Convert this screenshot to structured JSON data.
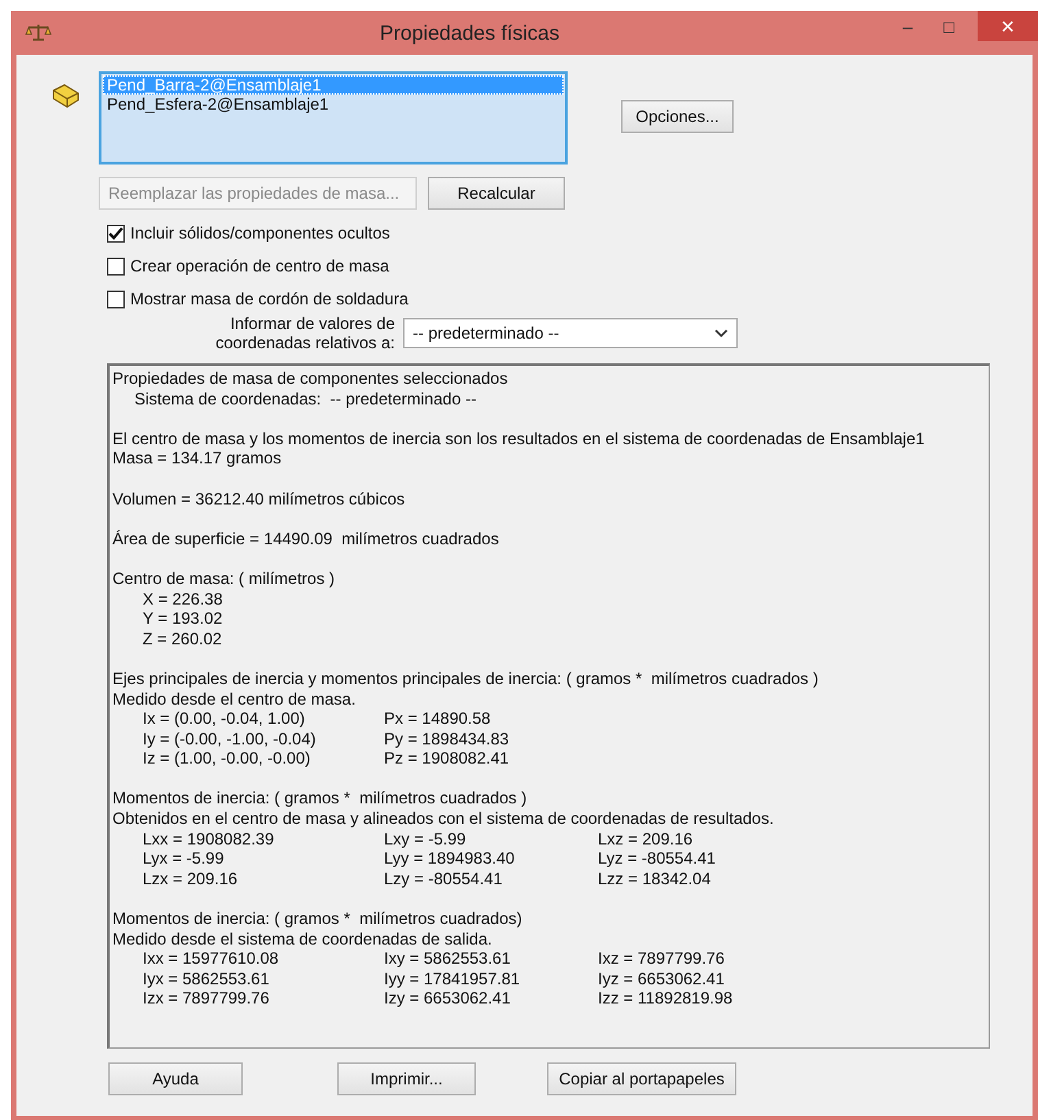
{
  "window": {
    "title": "Propiedades físicas",
    "controls": [
      "–",
      "□",
      "✕"
    ]
  },
  "components": [
    {
      "label": "Pend_Barra-2@Ensamblaje1",
      "selected": true
    },
    {
      "label": "Pend_Esfera-2@Ensamblaje1",
      "selected": false
    }
  ],
  "options_button": "Opciones...",
  "replace_button": {
    "label": "Reemplazar las propiedades de masa...",
    "disabled": true
  },
  "recalc_button": {
    "label": "Recalcular",
    "disabled": false
  },
  "checkboxes": [
    {
      "label": "Incluir sólidos/componentes ocultos",
      "checked": true
    },
    {
      "label": "Crear operación de centro de masa",
      "checked": false
    },
    {
      "label": "Mostrar masa de cordón de soldadura",
      "checked": false
    }
  ],
  "relative_label": [
    "Informar de valores de",
    "coordenadas relativos a:"
  ],
  "relative_select": {
    "value": "-- predeterminado --"
  },
  "results": [
    {
      "lines": [
        {
          "kind": "text",
          "text": "Propiedades de masa de componentes seleccionados"
        },
        {
          "kind": "sub",
          "text": "Sistema de coordenadas:  -- predeterminado --"
        }
      ]
    },
    {
      "lines": [
        {
          "kind": "text",
          "text": "El centro de masa y los momentos de inercia son los resultados en el sistema de coordenadas de Ensamblaje1"
        },
        {
          "kind": "text",
          "text": "Masa = 134.17 gramos"
        }
      ]
    },
    {
      "lines": [
        {
          "kind": "text",
          "text": "Volumen = 36212.40 milímetros cúbicos"
        }
      ]
    },
    {
      "lines": [
        {
          "kind": "text",
          "text": "Área de superficie = 14490.09  milímetros cuadrados"
        }
      ]
    },
    {
      "lines": [
        {
          "kind": "text",
          "text": "Centro de masa: ( milímetros )"
        },
        {
          "kind": "value",
          "text": "X = 226.38"
        },
        {
          "kind": "value",
          "text": "Y = 193.02"
        },
        {
          "kind": "value",
          "text": "Z = 260.02"
        }
      ]
    },
    {
      "lines": [
        {
          "kind": "text",
          "text": "Ejes principales de inercia y momentos principales de inercia: ( gramos *  milímetros cuadrados )"
        },
        {
          "kind": "text",
          "text": "Medido desde el centro de masa."
        },
        {
          "kind": "row",
          "cells": [
            "Ix = (0.00, -0.04, 1.00)",
            "Px = 14890.58"
          ]
        },
        {
          "kind": "row",
          "cells": [
            "Iy = (-0.00, -1.00, -0.04)",
            "Py = 1898434.83"
          ]
        },
        {
          "kind": "row",
          "cells": [
            "Iz = (1.00, -0.00, -0.00)",
            "Pz = 1908082.41"
          ]
        }
      ]
    },
    {
      "lines": [
        {
          "kind": "text",
          "text": "Momentos de inercia: ( gramos *  milímetros cuadrados )"
        },
        {
          "kind": "text",
          "text": "Obtenidos en el centro de masa y alineados con el sistema de coordenadas de resultados."
        },
        {
          "kind": "row",
          "cells": [
            "Lxx = 1908082.39",
            "Lxy = -5.99",
            "Lxz = 209.16"
          ]
        },
        {
          "kind": "row",
          "cells": [
            "Lyx = -5.99",
            "Lyy = 1894983.40",
            "Lyz = -80554.41"
          ]
        },
        {
          "kind": "row",
          "cells": [
            "Lzx = 209.16",
            "Lzy = -80554.41",
            "Lzz = 18342.04"
          ]
        }
      ]
    },
    {
      "lines": [
        {
          "kind": "text",
          "text": "Momentos de inercia: ( gramos *  milímetros cuadrados)"
        },
        {
          "kind": "text",
          "text": "Medido desde el sistema de coordenadas de salida."
        },
        {
          "kind": "row",
          "cells": [
            "Ixx = 15977610.08",
            "Ixy = 5862553.61",
            "Ixz = 7897799.76"
          ]
        },
        {
          "kind": "row",
          "cells": [
            "Iyx = 5862553.61",
            "Iyy = 17841957.81",
            "Iyz = 6653062.41"
          ]
        },
        {
          "kind": "row",
          "cells": [
            "Izx = 7897799.76",
            "Izy = 6653062.41",
            "Izz = 11892819.98"
          ]
        }
      ]
    }
  ],
  "footer_buttons": [
    "Ayuda",
    "Imprimir...",
    "Copiar al portapapeles"
  ]
}
